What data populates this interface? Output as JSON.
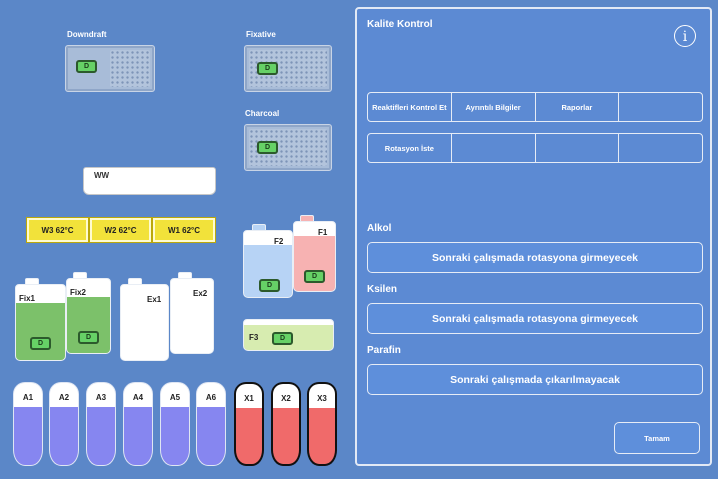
{
  "filters": {
    "downdraft": {
      "label": "Downdraft",
      "state": "D"
    },
    "fixative": {
      "label": "Fixative",
      "state": "D"
    },
    "charcoal": {
      "label": "Charcoal",
      "state": "D"
    }
  },
  "wax_bath": {
    "label": "WW"
  },
  "wax": [
    {
      "label": "W3  62°C"
    },
    {
      "label": "W2  62°C"
    },
    {
      "label": "W1  62°C"
    }
  ],
  "bottles": {
    "fix1": {
      "label": "Fix1",
      "state": "D"
    },
    "fix2": {
      "label": "Fix2",
      "state": "D"
    },
    "ex1": {
      "label": "Ex1"
    },
    "ex2": {
      "label": "Ex2"
    },
    "f2": {
      "label": "F2",
      "state": "D"
    },
    "f1": {
      "label": "F1",
      "state": "D"
    },
    "f3": {
      "label": "F3",
      "state": "D"
    }
  },
  "tubes": [
    "A1",
    "A2",
    "A3",
    "A4",
    "A5",
    "A6",
    "X1",
    "X2",
    "X3"
  ],
  "panel": {
    "title": "Kalite Kontrol",
    "info_glyph": "i",
    "tabs_row1": [
      "Reaktifleri Kontrol Et",
      "Ayrıntılı Bilgiler",
      "Raporlar",
      ""
    ],
    "tabs_row2": [
      "Rotasyon İste",
      "",
      "",
      ""
    ],
    "alcohol": {
      "heading": "Alkol",
      "button": "Sonraki çalışmada rotasyona girmeyecek"
    },
    "xylene": {
      "heading": "Ksilen",
      "button": "Sonraki çalışmada rotasyona girmeyecek"
    },
    "paraffin": {
      "heading": "Parafin",
      "button": "Sonraki çalışmada çıkarılmayacak"
    },
    "ok_button": "Tamam"
  },
  "colors": {
    "background": "#5b87c8",
    "wax": "#f2e23a",
    "fix_green": "#7cc16a",
    "f2_blue": "#b7d3f5",
    "f1_pink": "#f7b2b2",
    "f3_green": "#d7ecb0",
    "tube_blue": "#8686f0",
    "tube_red": "#f06a6a"
  }
}
